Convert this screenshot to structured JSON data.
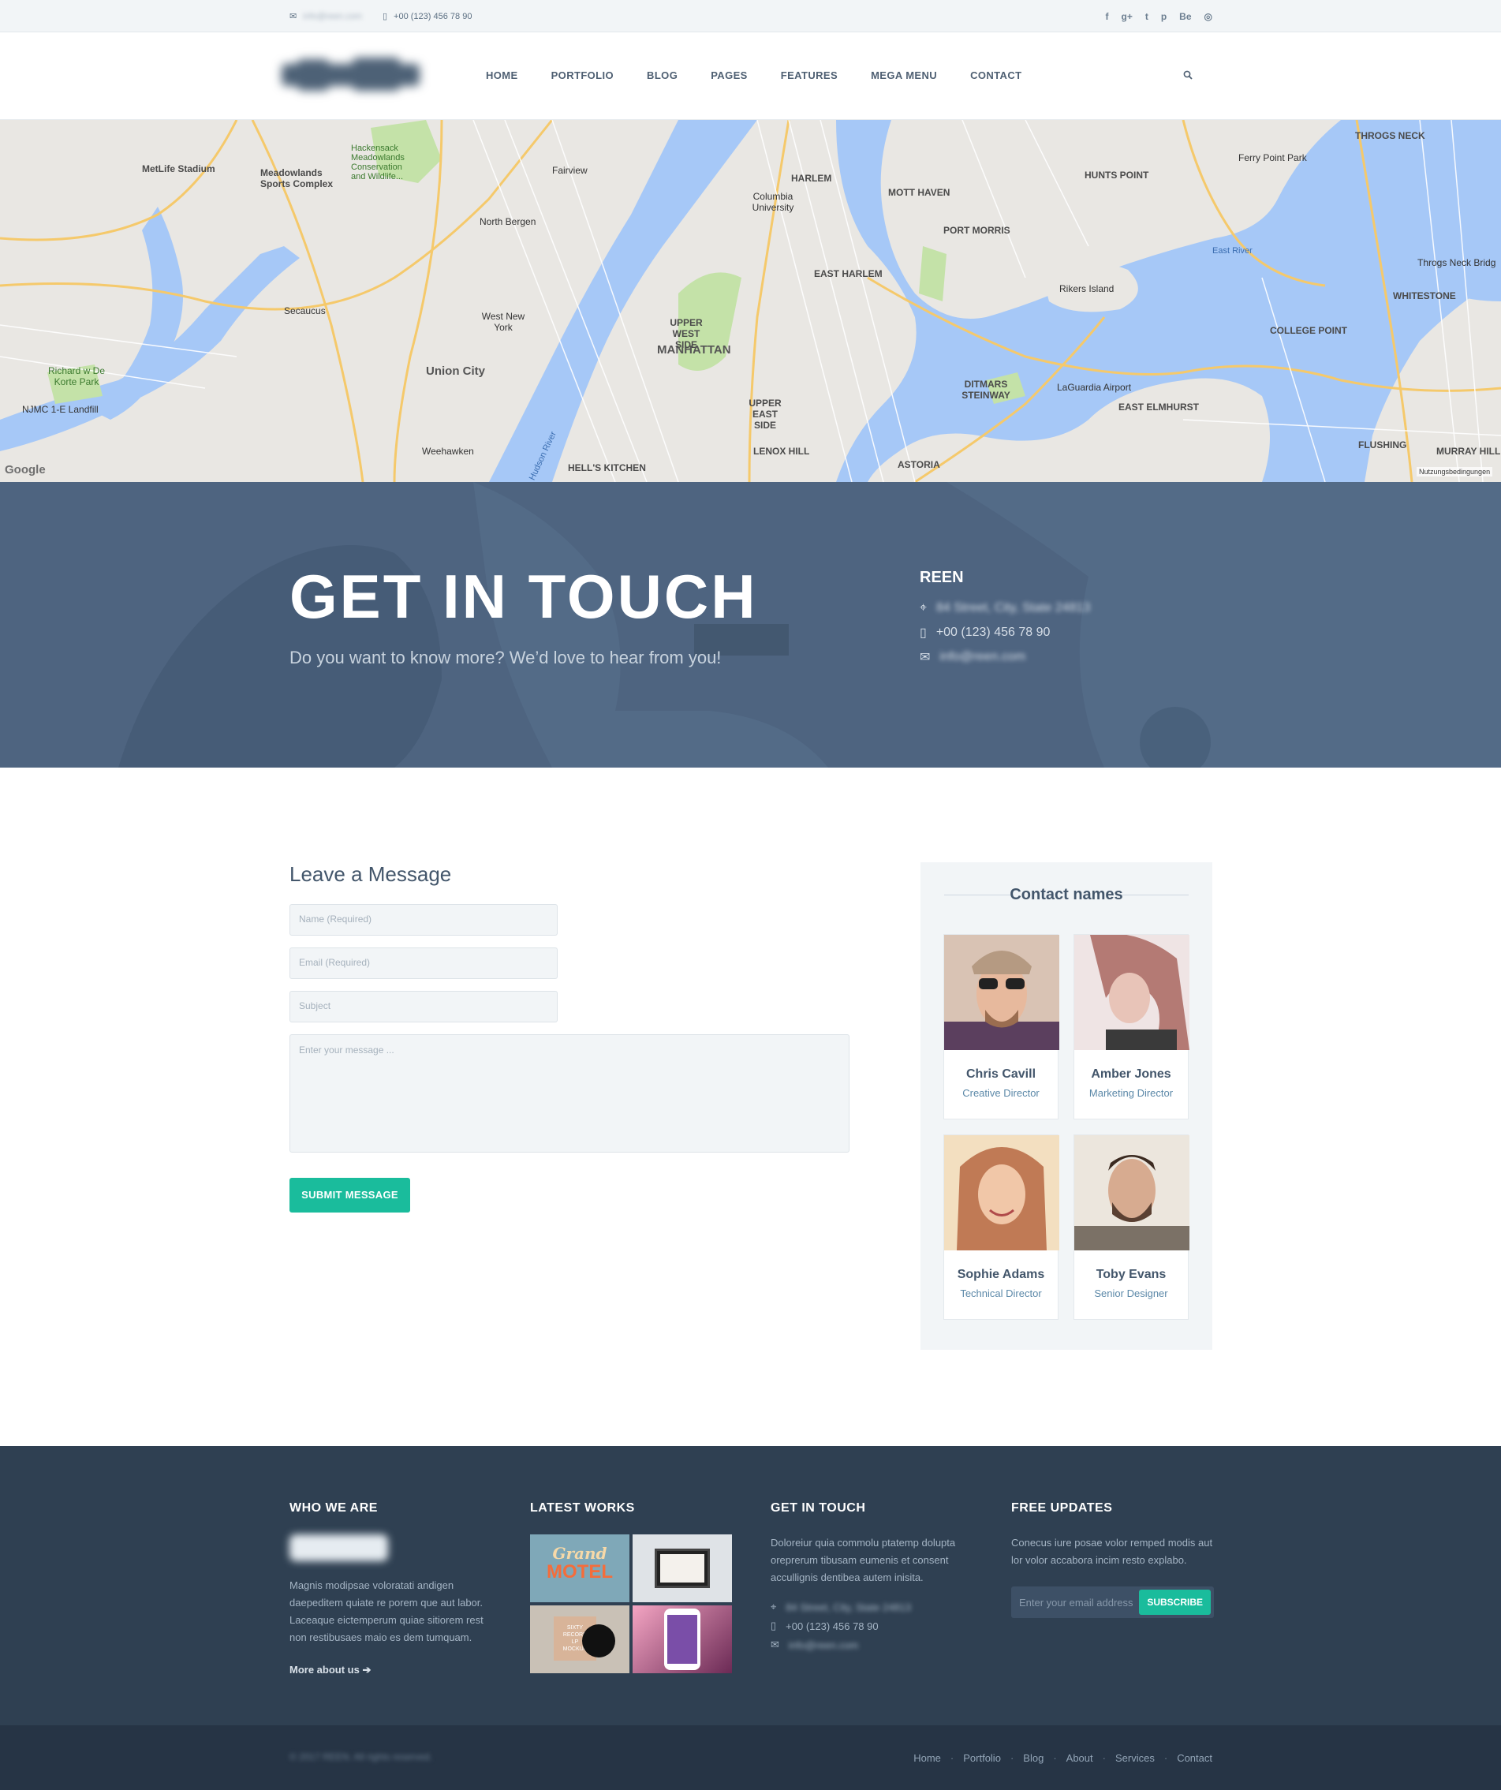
{
  "topbar": {
    "email": "info@reen.com",
    "phone": "+00 (123) 456 78 90",
    "socials": [
      "f",
      "g+",
      "t",
      "p",
      "Be",
      "◎"
    ]
  },
  "nav": {
    "items": [
      "HOME",
      "PORTFOLIO",
      "BLOG",
      "PAGES",
      "FEATURES",
      "MEGA MENU",
      "CONTACT"
    ]
  },
  "map": {
    "labels": [
      "MetLife Stadium",
      "Meadowlands Sports Complex",
      "Hackensack Meadowlands Conservation and Wildlife...",
      "Fairview",
      "North Bergen",
      "Secaucus",
      "West New York",
      "Union City",
      "Weehawken",
      "HARLEM",
      "Columbia University",
      "MOTT HAVEN",
      "PORT MORRIS",
      "HUNTS POINT",
      "EAST HARLEM",
      "UPPER WEST SIDE",
      "MANHATTAN",
      "UPPER EAST SIDE",
      "LENOX HILL",
      "HELL'S KITCHEN",
      "Rikers Island",
      "DITMARS STEINWAY",
      "LaGuardia Airport",
      "EAST ELMHURST",
      "ASTORIA",
      "Ferry Point Park",
      "THROGS NECK",
      "Throgs Neck Bridg",
      "WHITESTONE",
      "COLLEGE POINT",
      "FLUSHING",
      "MURRAY HILL",
      "Richard w De Korte Park",
      "NJMC 1-E Landfill",
      "East River",
      "Hudson River",
      "Google",
      "Nutzungsbedingungen"
    ]
  },
  "hero": {
    "title": "GET IN TOUCH",
    "subtitle": "Do you want to know more? We’d love to hear from you!",
    "company": "REEN",
    "address": "84 Street, City, State 24813",
    "phone": "+00 (123) 456 78 90",
    "email": "info@reen.com"
  },
  "form": {
    "heading": "Leave a Message",
    "name_ph": "Name (Required)",
    "email_ph": "Email (Required)",
    "subject_ph": "Subject",
    "message_ph": "Enter your message ...",
    "submit": "SUBMIT MESSAGE"
  },
  "contacts": {
    "heading": "Contact names",
    "people": [
      {
        "name": "Chris Cavill",
        "role": "Creative Director"
      },
      {
        "name": "Amber Jones",
        "role": "Marketing Director"
      },
      {
        "name": "Sophie Adams",
        "role": "Technical Director"
      },
      {
        "name": "Toby Evans",
        "role": "Senior Designer"
      }
    ]
  },
  "footer": {
    "who": {
      "title": "WHO WE ARE",
      "text": "Magnis modipsae voloratati andigen daepeditem quiate re porem que aut labor. Laceaque eictemperum quiae sitiorem rest non restibusaes maio es dem tumquam.",
      "more": "More about us"
    },
    "works": {
      "title": "LATEST WORKS",
      "thumb1_a": "Grand",
      "thumb1_b": "MOTEL",
      "thumb3": "SIXTY\nRECORD\nLP\nMOCKUP"
    },
    "touch": {
      "title": "GET IN TOUCH",
      "text": "Doloreiur quia commolu ptatemp dolupta oreprerum tibusam eumenis et consent accullignis dentibea autem inisita.",
      "address": "84 Street, City, State 24813",
      "phone": "+00 (123) 456 78 90",
      "email": "info@reen.com"
    },
    "updates": {
      "title": "FREE UPDATES",
      "text": "Conecus iure posae volor remped modis aut lor volor accabora incim resto explabo.",
      "placeholder": "Enter your email address",
      "button": "SUBSCRIBE"
    }
  },
  "bottom": {
    "copyright": "© 2017 REEN. All rights reserved.",
    "links": [
      "Home",
      "Portfolio",
      "Blog",
      "About",
      "Services",
      "Contact"
    ]
  },
  "colors": {
    "accent": "#1abc9c",
    "hero": "#4e6480",
    "footer": "#2f4052",
    "footer_bottom": "#263445"
  }
}
